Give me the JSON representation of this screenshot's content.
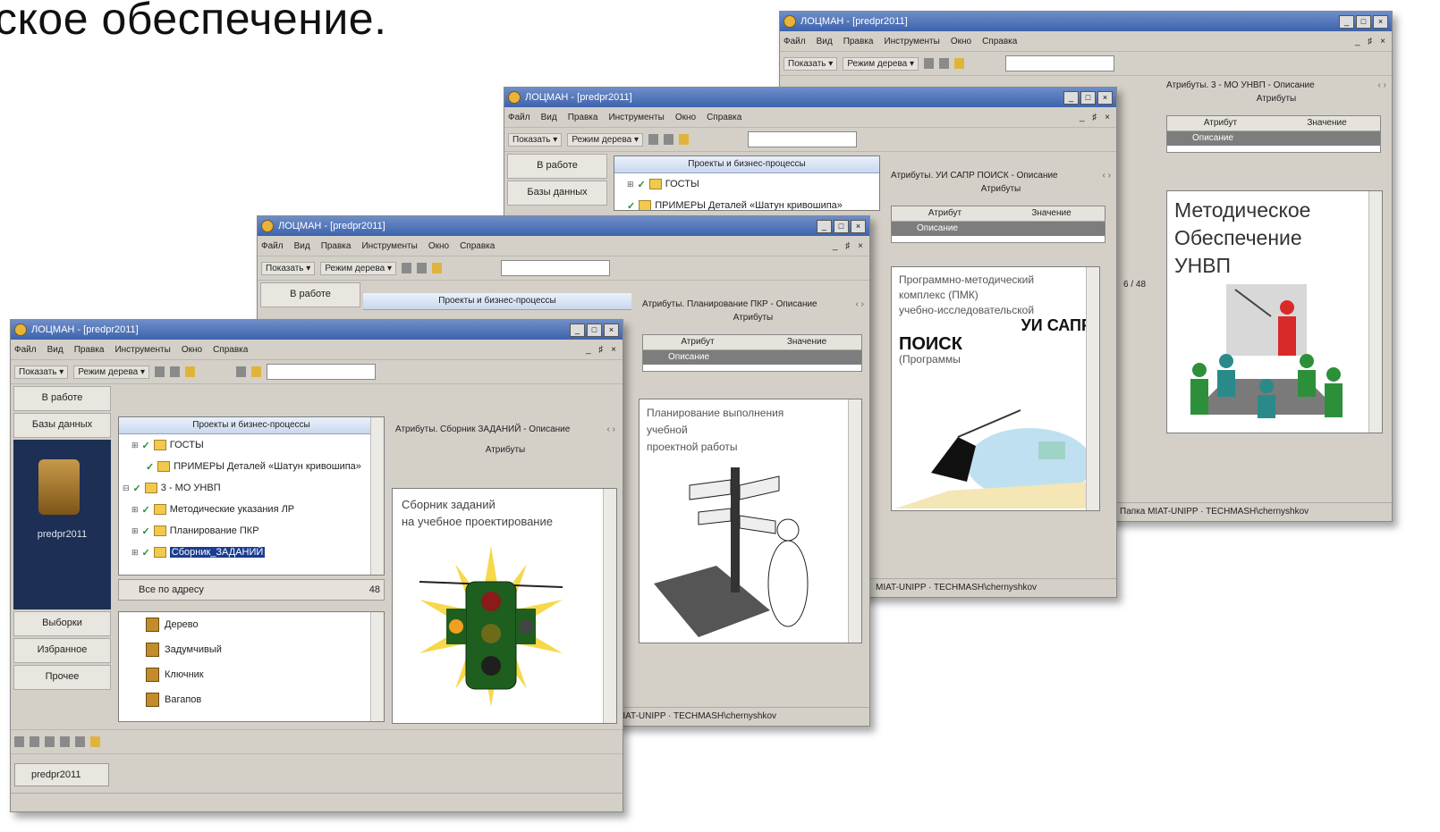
{
  "heading": "ское обеспечение.",
  "common": {
    "menu": [
      "Файл",
      "Вид",
      "Правка",
      "Инструменты",
      "Окно",
      "Справка"
    ],
    "win_controls": [
      "_",
      "□",
      "×"
    ],
    "menu_ctl": "_ ♯ ×",
    "show_btn": "Показать ▾",
    "tree_mode_btn": "Режим дерева ▾",
    "projects_header": "Проекты и бизнес-процессы",
    "attr_label": "Атрибуты",
    "attr_col": "Атрибут",
    "value_col": "Значение",
    "description_row": "Описание",
    "status_path": "MIAT-UNIPP · TECHMASH\\chernyshkov"
  },
  "win1": {
    "title": "ЛОЦМАН - [predpr2011]",
    "attr_title": "Атрибуты. Сборник ЗАДАНИЙ - Описание",
    "nav": [
      "В работе",
      "Базы данных"
    ],
    "nav_bottom": [
      "Выборки",
      "Избранное",
      "Прочее"
    ],
    "db_label": "predpr2011",
    "tree": [
      "ГОСТЫ",
      "ПРИМЕРЫ Деталей «Шатун кривошипа»",
      "3 - МО УНВП",
      "Методические указания ЛР",
      "Планирование ПКР",
      "Сборник_ЗАДАНИЙ"
    ],
    "group_label": "Все по адресу",
    "group_count": "48",
    "list": [
      "Дерево",
      "Задумчивый",
      "Ключник",
      "Вагапов"
    ],
    "doc_text": [
      "Сборник заданий",
      "на учебное проектирование"
    ],
    "taskbar": "predpr2011"
  },
  "win2": {
    "title": "ЛОЦМАН - [predpr2011]",
    "nav": [
      "В работе"
    ],
    "attr_title": "Атрибуты. Планирование ПКР - Описание",
    "doc_text": [
      "Планирование выполнения",
      "учебной",
      "проектной работы"
    ]
  },
  "win3": {
    "title": "ЛОЦМАН - [predpr2011]",
    "nav": [
      "В работе",
      "Базы данных"
    ],
    "tree": [
      "ГОСТЫ",
      "ПРИМЕРЫ Деталей «Шатун кривошипа»"
    ],
    "attr_title": "Атрибуты. УИ САПР ПОИСК - Описание",
    "doc_lines": [
      "Программно-методический",
      "комплекс (ПМК)",
      "учебно-исследовательской"
    ],
    "doc_big": "УИ САПР",
    "doc_big2": "ПОИСК",
    "doc_small": "(Программы"
  },
  "win4": {
    "title": "ЛОЦМАН - [predpr2011]",
    "attr_title": "Атрибуты. 3 - МО УНВП - Описание",
    "doc_title": [
      "Методическое",
      "Обеспечение",
      "УНВП"
    ],
    "count": "6 / 48",
    "status": "Папка MIAT-UNIPP · TECHMASH\\chernyshkov"
  }
}
